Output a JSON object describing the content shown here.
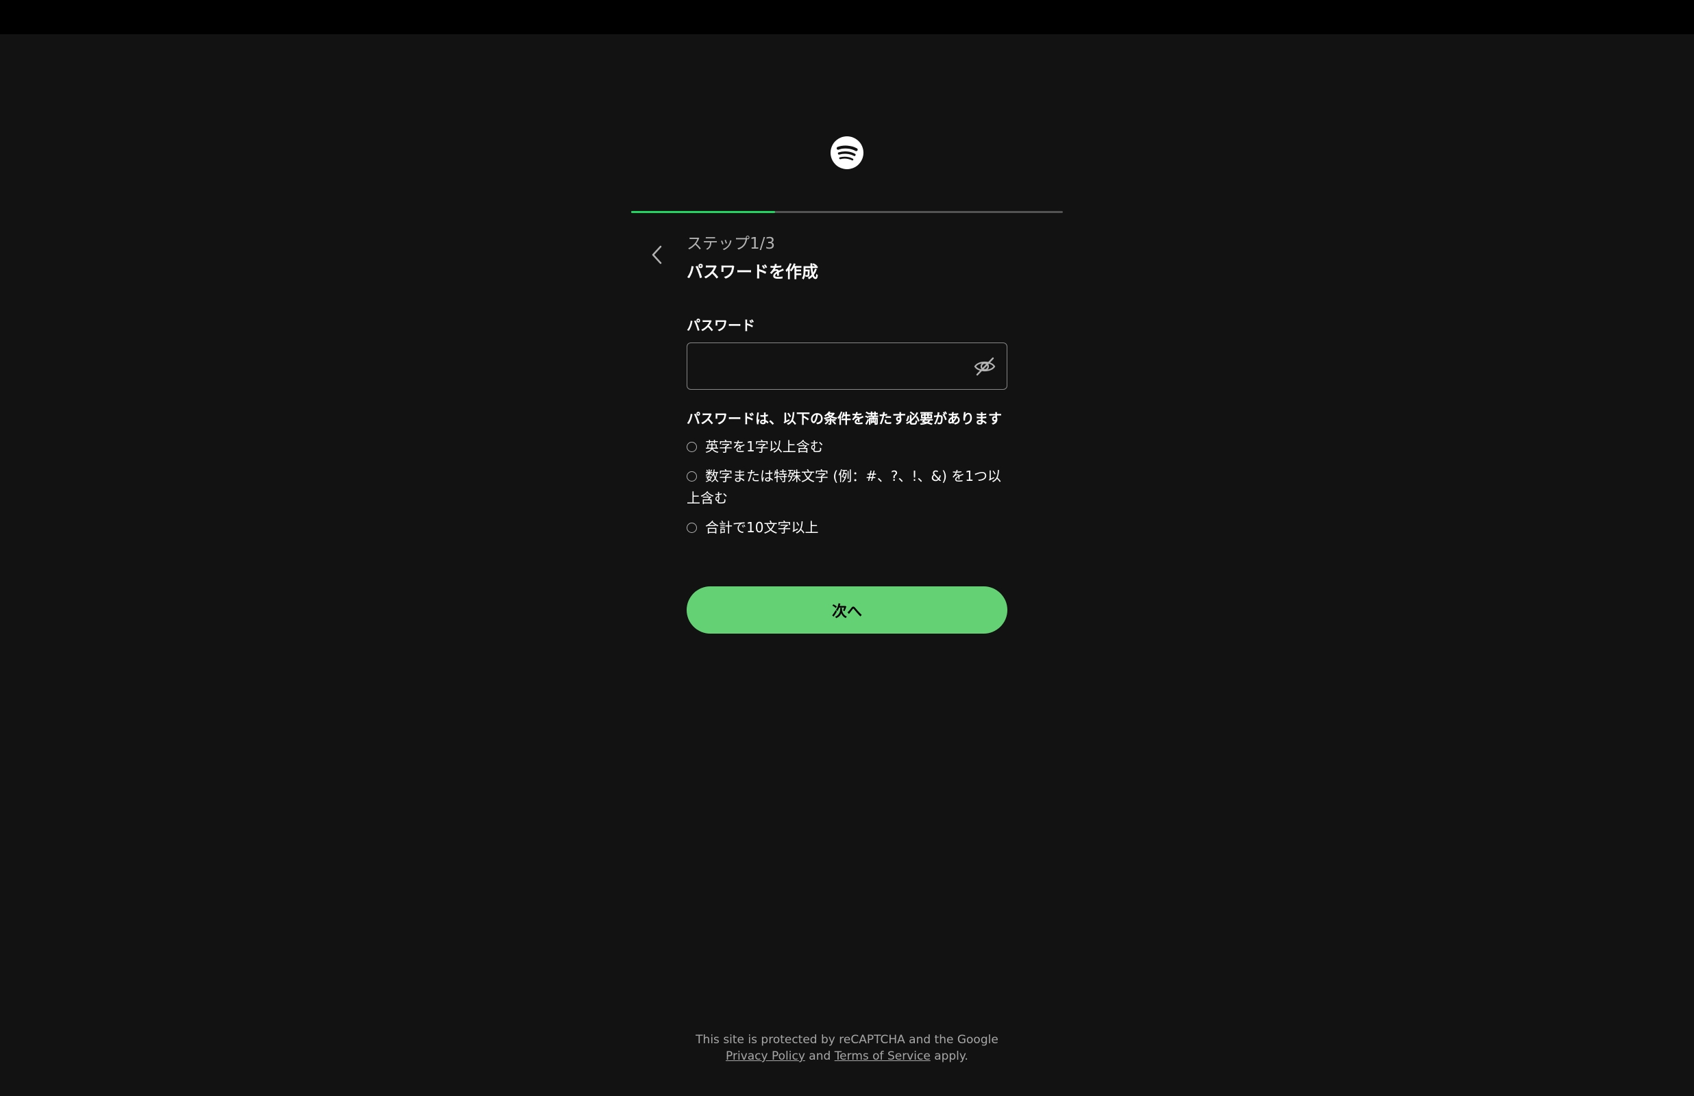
{
  "colors": {
    "background": "#121212",
    "topbar": "#000000",
    "accent": "#1ed760",
    "button": "#64d274",
    "muted_text": "#b3b3b3"
  },
  "header": {
    "logo_icon": "spotify-logo-icon"
  },
  "progress": {
    "fraction": 0.333,
    "step_label": "ステップ1/3",
    "step_title": "パスワードを作成"
  },
  "back_icon": "chevron-left-icon",
  "password": {
    "label": "パスワード",
    "value": "",
    "placeholder": "",
    "toggle_icon": "eye-slash-icon"
  },
  "requirements": {
    "title": "パスワードは、以下の条件を満たす必要があります",
    "items": [
      "英字を1字以上含む",
      "数字または特殊文字 (例：#、?、!、&) を1つ以上含む",
      "合計で10文字以上"
    ]
  },
  "next_button": {
    "label": "次へ"
  },
  "footer": {
    "line1": "This site is protected by reCAPTCHA and the Google",
    "privacy": "Privacy Policy",
    "and": "and",
    "terms": "Terms of Service",
    "apply": "apply."
  }
}
